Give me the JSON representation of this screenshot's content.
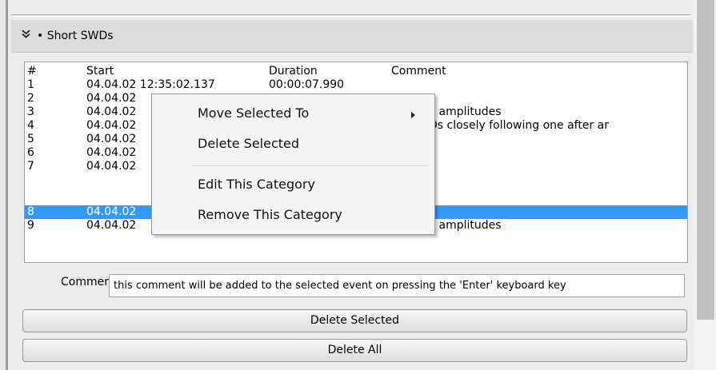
{
  "category": {
    "title": "• Short SWDs",
    "chevron": "»"
  },
  "events": {
    "columns": [
      "#",
      "Start",
      "Duration",
      "Comment"
    ],
    "rows": [
      {
        "num": "1",
        "start": "04.04.02 12:35:02.137",
        "duration": "00:00:07.990",
        "comment": ""
      },
      {
        "num": "2",
        "start": "04.04.02",
        "duration": "",
        "comment": ""
      },
      {
        "num": "3",
        "start": "04.04.02",
        "duration": "",
        "comment": "ar spike amplitudes"
      },
      {
        "num": "4",
        "start": "04.04.02",
        "duration": "",
        "comment": "ort SWDs closely following one after ar"
      },
      {
        "num": "5",
        "start": "04.04.02",
        "duration": "",
        "comment": ""
      },
      {
        "num": "6",
        "start": "04.04.02",
        "duration": "",
        "comment": ""
      },
      {
        "num": "7",
        "start": "04.04.02",
        "duration": "",
        "comment": ""
      },
      {
        "num": "8",
        "start": "04.04.02",
        "duration": "",
        "comment": "",
        "selected": true
      },
      {
        "num": "9",
        "start": "04.04.02",
        "duration": "",
        "comment": "ar spike amplitudes"
      }
    ],
    "selected_color": "#3399ff"
  },
  "context_menu": {
    "items": [
      "Move Selected To",
      "Delete Selected",
      "Edit This Category",
      "Remove This Category"
    ],
    "submenu_icon": "chevron-right-icon"
  },
  "comment": {
    "label": "Comment",
    "value": "this comment will be added to the selected event on pressing the 'Enter' keyboard key"
  },
  "buttons": {
    "delete_selected": "Delete Selected",
    "delete_all": "Delete All"
  }
}
